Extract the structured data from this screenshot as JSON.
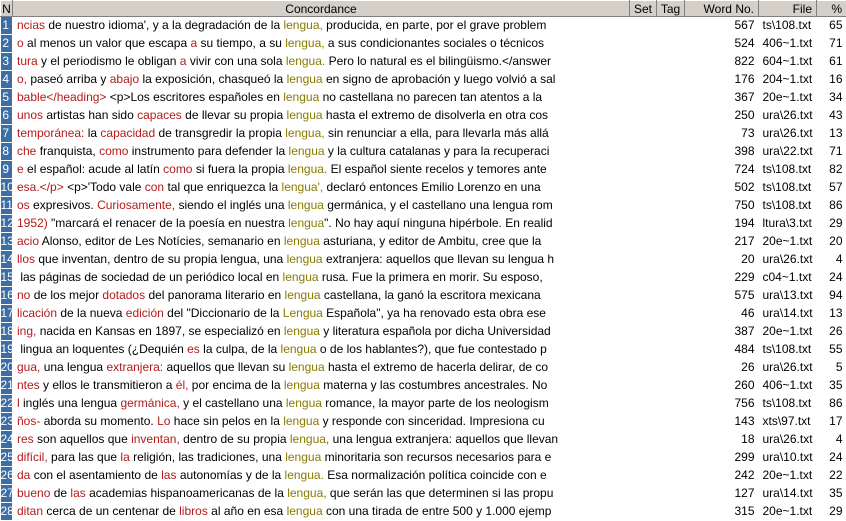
{
  "columns": {
    "n": "N",
    "concordance": "Concordance",
    "set": "Set",
    "tag": "Tag",
    "word_no": "Word No.",
    "file": "File",
    "pct": "%"
  },
  "rows": [
    {
      "n": "1",
      "left": [
        [
          "l",
          "ncias"
        ],
        [
          "",
          "de nuestro idioma', y a la degradación de la "
        ]
      ],
      "key": "lengua,",
      "right": " producida, en parte, por el grave problem",
      "wn": "567",
      "file": "ts\\108.txt",
      "pct": "65"
    },
    {
      "n": "2",
      "left": [
        [
          "l",
          "o"
        ],
        [
          "",
          "al menos un valor que escapa "
        ],
        [
          "l",
          "a"
        ],
        [
          "",
          "su tiempo, a su "
        ]
      ],
      "key": "lengua,",
      "right": " a sus condicionantes sociales o técnicos",
      "wn": "524",
      "file": "406~1.txt",
      "pct": "71"
    },
    {
      "n": "3",
      "left": [
        [
          "l",
          "tura"
        ],
        [
          "",
          "y el periodismo le obligan "
        ],
        [
          "l",
          "a"
        ],
        [
          "",
          "vivir con una sola "
        ]
      ],
      "key": "lengua.",
      "right": " Pero lo natural es el bilingüismo.</answer",
      "wn": "822",
      "file": "604~1.txt",
      "pct": "61"
    },
    {
      "n": "4",
      "left": [
        [
          "l",
          "o,"
        ],
        [
          "",
          "paseó arriba y "
        ],
        [
          "l",
          "abajo"
        ],
        [
          "",
          "la exposición, chasqueó la "
        ]
      ],
      "key": "lengua",
      "right": " en signo de aprobación y luego volvió a sal",
      "wn": "176",
      "file": "204~1.txt",
      "pct": "16"
    },
    {
      "n": "5",
      "left": [
        [
          "l",
          "bable</heading>"
        ],
        [
          "",
          "<p>Los escritores españoles en "
        ]
      ],
      "key": "lengua",
      "right": " no castellana no parecen tan atentos a la",
      "wn": "367",
      "file": "20e~1.txt",
      "pct": "34"
    },
    {
      "n": "6",
      "left": [
        [
          "l",
          "unos"
        ],
        [
          "",
          "artistas han sido "
        ],
        [
          "l",
          "capaces"
        ],
        [
          "",
          "de llevar su propia "
        ]
      ],
      "key": "lengua",
      "right": " hasta el extremo de disolverla en otra cos",
      "wn": "250",
      "file": "ura\\26.txt",
      "pct": "43"
    },
    {
      "n": "7",
      "left": [
        [
          "l",
          "temporánea:"
        ],
        [
          "",
          "la "
        ],
        [
          "l",
          "capacidad"
        ],
        [
          "",
          "de transgredir la propia "
        ]
      ],
      "key": "lengua,",
      "right": " sin renunciar a ella, para llevarla más allá",
      "wn": "73",
      "file": "ura\\26.txt",
      "pct": "13"
    },
    {
      "n": "8",
      "left": [
        [
          "l",
          "che"
        ],
        [
          "",
          "franquista, "
        ],
        [
          "l",
          "como"
        ],
        [
          "",
          "instrumento para defender la "
        ]
      ],
      "key": "lengua",
      "right": " y la cultura catalanas y para la recuperaci",
      "wn": "398",
      "file": "ura\\22.txt",
      "pct": "71"
    },
    {
      "n": "9",
      "left": [
        [
          "l",
          "e"
        ],
        [
          "",
          "el español: acude al latín "
        ],
        [
          "l",
          "como"
        ],
        [
          "",
          "si fuera la propia "
        ]
      ],
      "key": "lengua.",
      "right": " El español siente recelos y temores ante",
      "wn": "724",
      "file": "ts\\108.txt",
      "pct": "82"
    },
    {
      "n": "10",
      "left": [
        [
          "l",
          "esa.</p>"
        ],
        [
          "",
          "<p>'Todo vale "
        ],
        [
          "l",
          "con"
        ],
        [
          "",
          "tal que enriquezca la "
        ]
      ],
      "key": "lengua',",
      "right": " declaró entonces Emilio Lorenzo en una",
      "wn": "502",
      "file": "ts\\108.txt",
      "pct": "57"
    },
    {
      "n": "11",
      "left": [
        [
          "l",
          "os"
        ],
        [
          "",
          "expresivos. "
        ],
        [
          "l",
          "Curiosamente,"
        ],
        [
          "",
          "siendo el inglés una "
        ]
      ],
      "key": "lengua",
      "right": " germánica, y el castellano una lengua rom",
      "wn": "750",
      "file": "ts\\108.txt",
      "pct": "86"
    },
    {
      "n": "12",
      "left": [
        [
          "l",
          "1952)"
        ],
        [
          "",
          "\"marcará el renacer de la poesía en nuestra "
        ]
      ],
      "key": "lengua",
      "right": "\". No hay aquí ninguna hipérbole. En realid",
      "wn": "194",
      "file": "ltura\\3.txt",
      "pct": "29"
    },
    {
      "n": "13",
      "left": [
        [
          "l",
          "acio"
        ],
        [
          "",
          "Alonso, editor de Les Notícies, semanario en "
        ]
      ],
      "key": "lengua",
      "right": " asturiana, y editor de Ambitu, cree que la",
      "wn": "217",
      "file": "20e~1.txt",
      "pct": "20"
    },
    {
      "n": "14",
      "left": [
        [
          "l",
          "llos"
        ],
        [
          "",
          "que inventan, dentro de su propia lengua, una "
        ]
      ],
      "key": "lengua",
      "right": " extranjera: aquellos que llevan su lengua h",
      "wn": "20",
      "file": "ura\\26.txt",
      "pct": "4"
    },
    {
      "n": "15",
      "left": [
        [
          "l",
          ""
        ],
        [
          "",
          "las páginas de sociedad de un periódico local en "
        ]
      ],
      "key": "lengua",
      "right": " rusa. Fue la primera en morir. Su esposo,",
      "wn": "229",
      "file": "c04~1.txt",
      "pct": "24"
    },
    {
      "n": "16",
      "left": [
        [
          "l",
          "no"
        ],
        [
          "",
          "de los mejor "
        ],
        [
          "l",
          "dotados"
        ],
        [
          "",
          "del panorama literario en "
        ]
      ],
      "key": "lengua",
      "right": " castellana, la ganó la escritora mexicana",
      "wn": "575",
      "file": "ura\\13.txt",
      "pct": "94"
    },
    {
      "n": "17",
      "left": [
        [
          "l",
          "licación"
        ],
        [
          "",
          "de la nueva "
        ],
        [
          "l",
          "edición"
        ],
        [
          "",
          "del \"Diccionario de la "
        ]
      ],
      "key": "Lengua",
      "right": " Española\", ya ha renovado esta obra ese",
      "wn": "46",
      "file": "ura\\14.txt",
      "pct": "13"
    },
    {
      "n": "18",
      "left": [
        [
          "l",
          "ing,"
        ],
        [
          "",
          "nacida en Kansas en 1897, se especializó en "
        ]
      ],
      "key": "lengua",
      "right": " y literatura española por dicha Universidad",
      "wn": "387",
      "file": "20e~1.txt",
      "pct": "26"
    },
    {
      "n": "19",
      "left": [
        [
          "l",
          ""
        ],
        [
          "",
          "lingua an loquentes (¿Dequién "
        ],
        [
          "l",
          "es"
        ],
        [
          "",
          "la culpa, de la "
        ]
      ],
      "key": "lengua",
      "right": " o de los hablantes?), que fue contestado p",
      "wn": "484",
      "file": "ts\\108.txt",
      "pct": "55"
    },
    {
      "n": "20",
      "left": [
        [
          "l",
          "gua,"
        ],
        [
          "",
          "una lengua "
        ],
        [
          "l",
          "extranjera:"
        ],
        [
          "",
          "aquellos que llevan su "
        ]
      ],
      "key": "lengua",
      "right": " hasta el extremo de hacerla delirar, de co",
      "wn": "26",
      "file": "ura\\26.txt",
      "pct": "5"
    },
    {
      "n": "21",
      "left": [
        [
          "l",
          "ntes"
        ],
        [
          "",
          "y ellos le transmitieron a "
        ],
        [
          "l",
          "él,"
        ],
        [
          "",
          "por encima de la "
        ]
      ],
      "key": "lengua",
      "right": " materna y las costumbres ancestrales. No",
      "wn": "260",
      "file": "406~1.txt",
      "pct": "35"
    },
    {
      "n": "22",
      "left": [
        [
          "l",
          "l"
        ],
        [
          "",
          "inglés una lengua "
        ],
        [
          "l",
          "germánica,"
        ],
        [
          "",
          "y el castellano una "
        ]
      ],
      "key": "lengua",
      "right": " romance, la mayor parte de los neologism",
      "wn": "756",
      "file": "ts\\108.txt",
      "pct": "86"
    },
    {
      "n": "23",
      "left": [
        [
          "l",
          "ños-"
        ],
        [
          "",
          "aborda su momento. "
        ],
        [
          "l",
          "Lo"
        ],
        [
          "",
          "hace sin pelos en la "
        ]
      ],
      "key": "lengua",
      "right": " y responde con sinceridad. Impresiona cu",
      "wn": "143",
      "file": "xts\\97.txt",
      "pct": "17"
    },
    {
      "n": "24",
      "left": [
        [
          "l",
          "res"
        ],
        [
          "",
          "son aquellos que "
        ],
        [
          "l",
          "inventan,"
        ],
        [
          "",
          "dentro de su propia "
        ]
      ],
      "key": "lengua,",
      "right": " una lengua extranjera: aquellos que llevan",
      "wn": "18",
      "file": "ura\\26.txt",
      "pct": "4"
    },
    {
      "n": "25",
      "left": [
        [
          "l",
          "difícil,"
        ],
        [
          "",
          "para las que "
        ],
        [
          "l",
          "la"
        ],
        [
          "",
          "religión, las tradiciones, una "
        ]
      ],
      "key": "lengua",
      "right": " minoritaria son recursos necesarios para e",
      "wn": "299",
      "file": "ura\\10.txt",
      "pct": "24"
    },
    {
      "n": "26",
      "left": [
        [
          "l",
          "da"
        ],
        [
          "",
          "con el asentamiento de "
        ],
        [
          "l",
          "las"
        ],
        [
          "",
          "autonomías y de la "
        ]
      ],
      "key": "lengua.",
      "right": " Esa normalización política coincide con e",
      "wn": "242",
      "file": "20e~1.txt",
      "pct": "22"
    },
    {
      "n": "27",
      "left": [
        [
          "l",
          "bueno"
        ],
        [
          "",
          "de "
        ],
        [
          "l",
          "las"
        ],
        [
          "",
          "academias hispanoamericanas de la "
        ]
      ],
      "key": "lengua,",
      "right": " que serán las que determinen si las propu",
      "wn": "127",
      "file": "ura\\14.txt",
      "pct": "35"
    },
    {
      "n": "28",
      "left": [
        [
          "l",
          "ditan"
        ],
        [
          "",
          "cerca de un centenar de "
        ],
        [
          "l",
          "libros"
        ],
        [
          "",
          "al año en esa "
        ]
      ],
      "key": "lengua",
      "right": " con una tirada de entre 500 y 1.000 ejemp",
      "wn": "315",
      "file": "20e~1.txt",
      "pct": "29"
    }
  ]
}
